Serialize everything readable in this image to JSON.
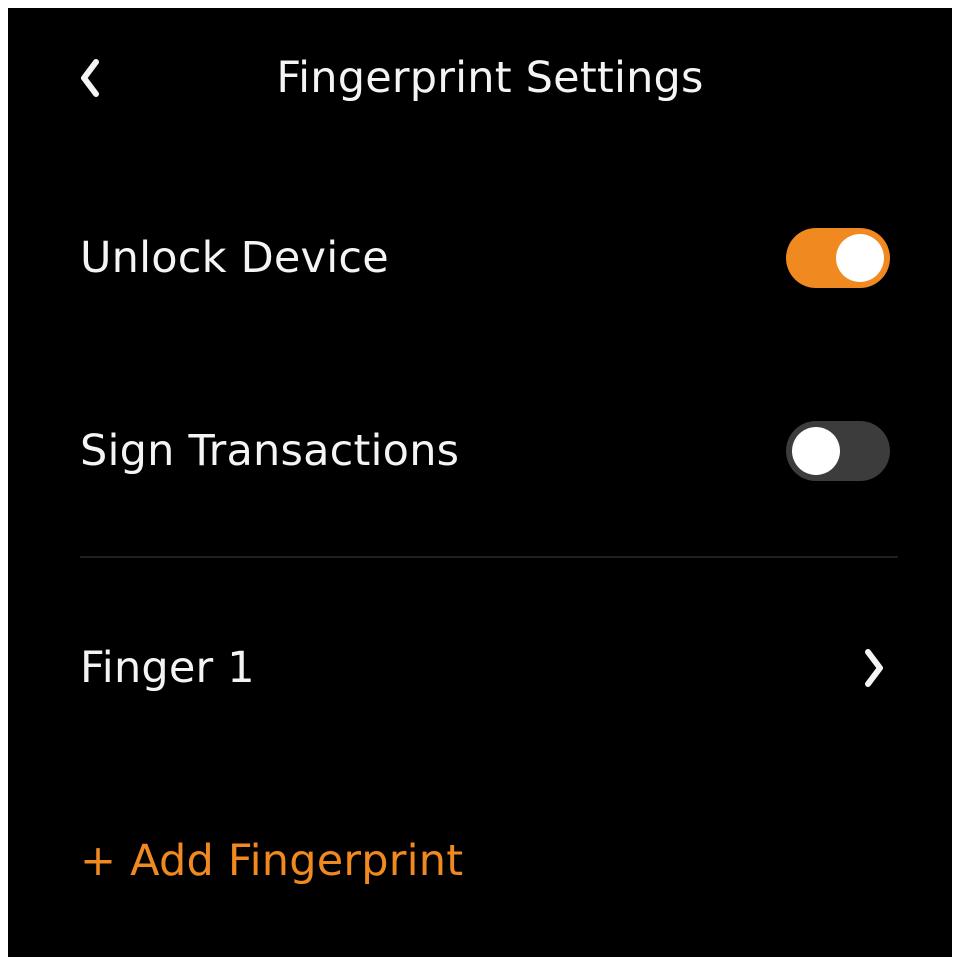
{
  "header": {
    "title": "Fingerprint Settings",
    "back_icon": "chevron-left-icon"
  },
  "settings": [
    {
      "label": "Unlock Device",
      "enabled": true
    },
    {
      "label": "Sign Transactions",
      "enabled": false
    }
  ],
  "fingers": [
    {
      "label": "Finger 1",
      "icon": "chevron-right-icon"
    }
  ],
  "add_fingerprint_label": "+ Add Fingerprint",
  "colors": {
    "background": "#000000",
    "text": "#f4f4f4",
    "accent": "#f0891f",
    "toggle_off": "#3c3c3c",
    "divider": "#1f1f1f"
  }
}
